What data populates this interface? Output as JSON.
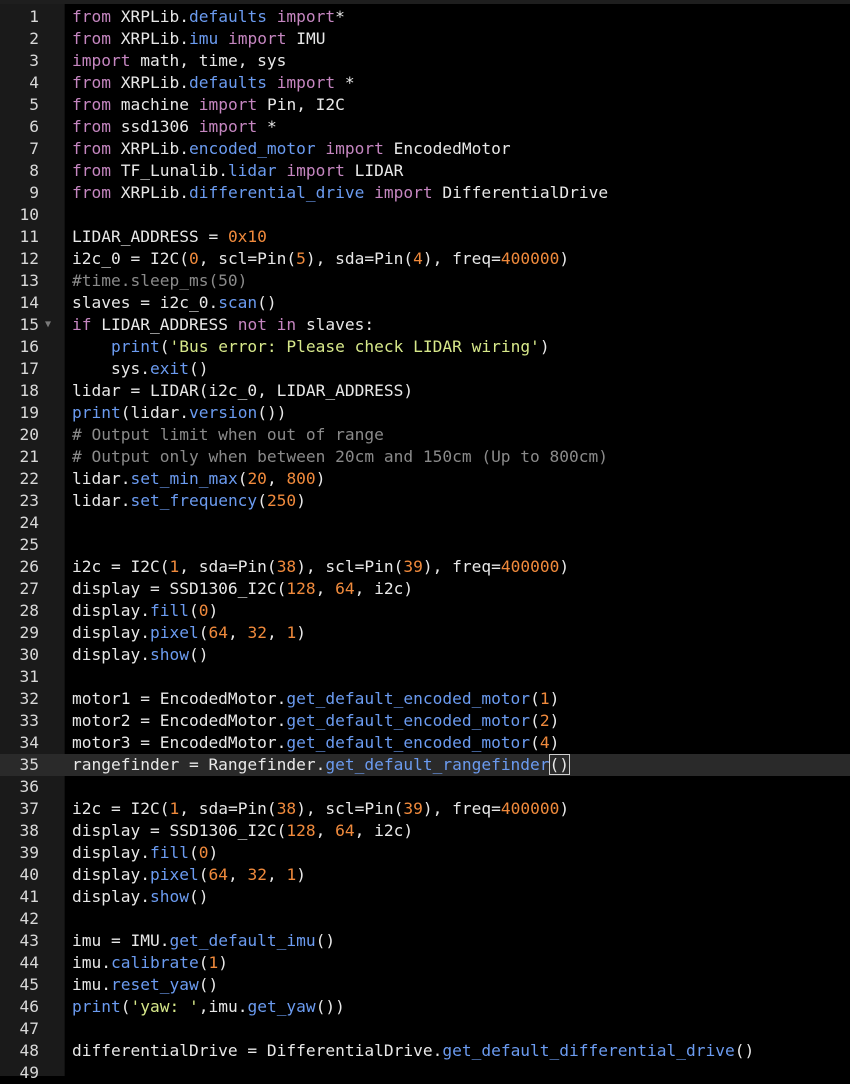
{
  "editor": {
    "language": "python",
    "active_line": 35,
    "fold_marker_line": 15,
    "lines": [
      {
        "n": "1",
        "t": [
          [
            "kw",
            "from"
          ],
          [
            "",
            "XRPLib."
          ],
          [
            "mod",
            "defaults"
          ],
          [
            "",
            "import"
          ],
          [
            "",
            "*"
          ]
        ]
      },
      {
        "n": "2",
        "t": [
          [
            "kw",
            "from"
          ],
          [
            "",
            "XRPLib."
          ],
          [
            "mod",
            "imu"
          ],
          [
            "kw",
            "import"
          ],
          [
            "",
            "IMU"
          ]
        ]
      },
      {
        "n": "3",
        "t": [
          [
            "kw",
            "import"
          ],
          [
            "",
            "math, time, sys"
          ]
        ]
      },
      {
        "n": "4",
        "t": [
          [
            "kw",
            "from"
          ],
          [
            "",
            "XRPLib."
          ],
          [
            "mod",
            "defaults"
          ],
          [
            "kw",
            "import"
          ],
          [
            "",
            "*"
          ]
        ]
      },
      {
        "n": "5",
        "t": [
          [
            "kw",
            "from"
          ],
          [
            "",
            "machine"
          ],
          [
            "kw",
            "import"
          ],
          [
            "",
            "Pin, I2C"
          ]
        ]
      },
      {
        "n": "6",
        "t": [
          [
            "kw",
            "from"
          ],
          [
            "",
            "ssd1306"
          ],
          [
            "kw",
            "import"
          ],
          [
            "",
            "*"
          ]
        ]
      },
      {
        "n": "7",
        "t": [
          [
            "kw",
            "from"
          ],
          [
            "",
            "XRPLib."
          ],
          [
            "mod",
            "encoded_motor"
          ],
          [
            "kw",
            "import"
          ],
          [
            "",
            "EncodedMotor"
          ]
        ]
      },
      {
        "n": "8",
        "t": [
          [
            "kw",
            "from"
          ],
          [
            "",
            "TF_Lunalib."
          ],
          [
            "mod",
            "lidar"
          ],
          [
            "kw",
            "import"
          ],
          [
            "",
            "LIDAR"
          ]
        ]
      },
      {
        "n": "9",
        "t": [
          [
            "kw",
            "from"
          ],
          [
            "",
            "XRPLib."
          ],
          [
            "mod",
            "differential_drive"
          ],
          [
            "kw",
            "import"
          ],
          [
            "",
            "DifferentialDrive"
          ]
        ]
      },
      {
        "n": "10",
        "t": []
      },
      {
        "n": "11",
        "t": [
          [
            "",
            "LIDAR_ADDRESS = "
          ],
          [
            "num",
            "0x10"
          ]
        ]
      },
      {
        "n": "12",
        "t": [
          [
            "",
            "i2c_0 = I2C("
          ],
          [
            "num",
            "0"
          ],
          [
            "",
            ", scl=Pin("
          ],
          [
            "num",
            "5"
          ],
          [
            "",
            "), sda=Pin("
          ],
          [
            "num",
            "4"
          ],
          [
            "",
            "), freq="
          ],
          [
            "num",
            "400000"
          ],
          [
            "",
            ")"
          ]
        ]
      },
      {
        "n": "13",
        "t": [
          [
            "cmt",
            "#time.sleep_ms(50)"
          ]
        ]
      },
      {
        "n": "14",
        "t": [
          [
            "",
            "slaves = i2c_0."
          ],
          [
            "fn",
            "scan"
          ],
          [
            "",
            "()"
          ]
        ]
      },
      {
        "n": "15",
        "t": [
          [
            "kw",
            "if"
          ],
          [
            "",
            "LIDAR_ADDRESS"
          ],
          [
            "kw",
            "not in"
          ],
          [
            "",
            "slaves:"
          ]
        ]
      },
      {
        "n": "16",
        "t": [
          [
            "",
            "    "
          ],
          [
            "fn",
            "print"
          ],
          [
            "",
            "("
          ],
          [
            "str",
            "'Bus error: Please check LIDAR wiring'"
          ],
          [
            "",
            ")"
          ]
        ]
      },
      {
        "n": "17",
        "t": [
          [
            "",
            "    sys."
          ],
          [
            "fn",
            "exit"
          ],
          [
            "",
            "()"
          ]
        ]
      },
      {
        "n": "18",
        "t": [
          [
            "",
            "lidar = LIDAR(i2c_0, LIDAR_ADDRESS)"
          ]
        ]
      },
      {
        "n": "19",
        "t": [
          [
            "fn",
            "print"
          ],
          [
            "",
            "(lidar."
          ],
          [
            "fn",
            "version"
          ],
          [
            "",
            "())"
          ]
        ]
      },
      {
        "n": "20",
        "t": [
          [
            "cmt",
            "# Output limit when out of range"
          ]
        ]
      },
      {
        "n": "21",
        "t": [
          [
            "cmt",
            "# Output only when between 20cm and 150cm (Up to 800cm)"
          ]
        ]
      },
      {
        "n": "22",
        "t": [
          [
            "",
            "lidar."
          ],
          [
            "fn",
            "set_min_max"
          ],
          [
            "",
            "("
          ],
          [
            "num",
            "20"
          ],
          [
            "",
            ", "
          ],
          [
            "num",
            "800"
          ],
          [
            "",
            ")"
          ]
        ]
      },
      {
        "n": "23",
        "t": [
          [
            "",
            "lidar."
          ],
          [
            "fn",
            "set_frequency"
          ],
          [
            "",
            "("
          ],
          [
            "num",
            "250"
          ],
          [
            "",
            ")"
          ]
        ]
      },
      {
        "n": "24",
        "t": []
      },
      {
        "n": "25",
        "t": []
      },
      {
        "n": "26",
        "t": [
          [
            "",
            "i2c = I2C("
          ],
          [
            "num",
            "1"
          ],
          [
            "",
            ", sda=Pin("
          ],
          [
            "num",
            "38"
          ],
          [
            "",
            "), scl=Pin("
          ],
          [
            "num",
            "39"
          ],
          [
            "",
            "), freq="
          ],
          [
            "num",
            "400000"
          ],
          [
            "",
            ")"
          ]
        ]
      },
      {
        "n": "27",
        "t": [
          [
            "",
            "display = SSD1306_I2C("
          ],
          [
            "num",
            "128"
          ],
          [
            "",
            ", "
          ],
          [
            "num",
            "64"
          ],
          [
            "",
            ", i2c)"
          ]
        ]
      },
      {
        "n": "28",
        "t": [
          [
            "",
            "display."
          ],
          [
            "fn",
            "fill"
          ],
          [
            "",
            "("
          ],
          [
            "num",
            "0"
          ],
          [
            "",
            ")"
          ]
        ]
      },
      {
        "n": "29",
        "t": [
          [
            "",
            "display."
          ],
          [
            "fn",
            "pixel"
          ],
          [
            "",
            "("
          ],
          [
            "num",
            "64"
          ],
          [
            "",
            ", "
          ],
          [
            "num",
            "32"
          ],
          [
            "",
            ", "
          ],
          [
            "num",
            "1"
          ],
          [
            "",
            ")"
          ]
        ]
      },
      {
        "n": "30",
        "t": [
          [
            "",
            "display."
          ],
          [
            "fn",
            "show"
          ],
          [
            "",
            "()"
          ]
        ]
      },
      {
        "n": "31",
        "t": []
      },
      {
        "n": "32",
        "t": [
          [
            "",
            "motor1 = EncodedMotor."
          ],
          [
            "fn",
            "get_default_encoded_motor"
          ],
          [
            "",
            "("
          ],
          [
            "num",
            "1"
          ],
          [
            "",
            ")"
          ]
        ]
      },
      {
        "n": "33",
        "t": [
          [
            "",
            "motor2 = EncodedMotor."
          ],
          [
            "fn",
            "get_default_encoded_motor"
          ],
          [
            "",
            "("
          ],
          [
            "num",
            "2"
          ],
          [
            "",
            ")"
          ]
        ]
      },
      {
        "n": "34",
        "t": [
          [
            "",
            "motor3 = EncodedMotor."
          ],
          [
            "fn",
            "get_default_encoded_motor"
          ],
          [
            "",
            "("
          ],
          [
            "num",
            "4"
          ],
          [
            "",
            ")"
          ]
        ]
      },
      {
        "n": "35",
        "t": [
          [
            "",
            "rangefinder = Rangefinder."
          ],
          [
            "fn",
            "get_default_rangefinder"
          ],
          [
            "cursor",
            "()"
          ]
        ]
      },
      {
        "n": "36",
        "t": []
      },
      {
        "n": "37",
        "t": [
          [
            "",
            "i2c = I2C("
          ],
          [
            "num",
            "1"
          ],
          [
            "",
            ", sda=Pin("
          ],
          [
            "num",
            "38"
          ],
          [
            "",
            "), scl=Pin("
          ],
          [
            "num",
            "39"
          ],
          [
            "",
            "), freq="
          ],
          [
            "num",
            "400000"
          ],
          [
            "",
            ")"
          ]
        ]
      },
      {
        "n": "38",
        "t": [
          [
            "",
            "display = SSD1306_I2C("
          ],
          [
            "num",
            "128"
          ],
          [
            "",
            ", "
          ],
          [
            "num",
            "64"
          ],
          [
            "",
            ", i2c)"
          ]
        ]
      },
      {
        "n": "39",
        "t": [
          [
            "",
            "display."
          ],
          [
            "fn",
            "fill"
          ],
          [
            "",
            "("
          ],
          [
            "num",
            "0"
          ],
          [
            "",
            ")"
          ]
        ]
      },
      {
        "n": "40",
        "t": [
          [
            "",
            "display."
          ],
          [
            "fn",
            "pixel"
          ],
          [
            "",
            "("
          ],
          [
            "num",
            "64"
          ],
          [
            "",
            ", "
          ],
          [
            "num",
            "32"
          ],
          [
            "",
            ", "
          ],
          [
            "num",
            "1"
          ],
          [
            "",
            ")"
          ]
        ]
      },
      {
        "n": "41",
        "t": [
          [
            "",
            "display."
          ],
          [
            "fn",
            "show"
          ],
          [
            "",
            "()"
          ]
        ]
      },
      {
        "n": "42",
        "t": []
      },
      {
        "n": "43",
        "t": [
          [
            "",
            "imu = IMU."
          ],
          [
            "fn",
            "get_default_imu"
          ],
          [
            "",
            "()"
          ]
        ]
      },
      {
        "n": "44",
        "t": [
          [
            "",
            "imu."
          ],
          [
            "fn",
            "calibrate"
          ],
          [
            "",
            "("
          ],
          [
            "num",
            "1"
          ],
          [
            "",
            ")"
          ]
        ]
      },
      {
        "n": "45",
        "t": [
          [
            "",
            "imu."
          ],
          [
            "fn",
            "reset_yaw"
          ],
          [
            "",
            "()"
          ]
        ]
      },
      {
        "n": "46",
        "t": [
          [
            "fn",
            "print"
          ],
          [
            "",
            "("
          ],
          [
            "str",
            "'yaw: '"
          ],
          [
            "",
            ",imu."
          ],
          [
            "fn",
            "get_yaw"
          ],
          [
            "",
            "())"
          ]
        ]
      },
      {
        "n": "47",
        "t": []
      },
      {
        "n": "48",
        "t": [
          [
            "",
            "differentialDrive = DifferentialDrive."
          ],
          [
            "fn",
            "get_default_differential_drive"
          ],
          [
            "",
            "()"
          ]
        ]
      },
      {
        "n": "49",
        "t": []
      }
    ]
  }
}
